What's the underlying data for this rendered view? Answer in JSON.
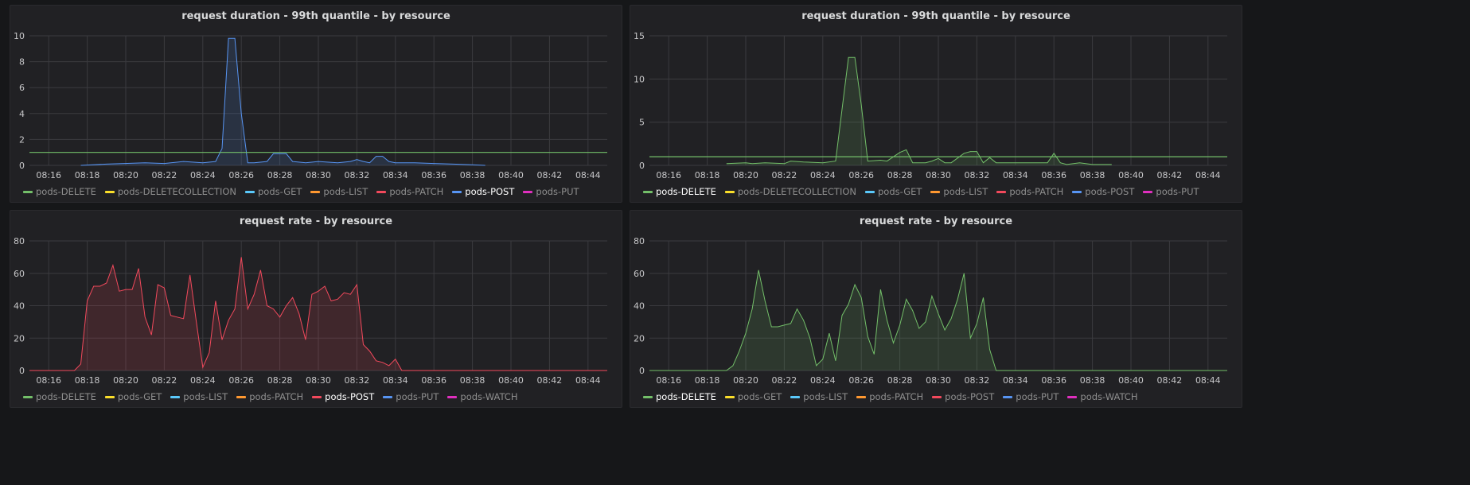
{
  "colors": {
    "DELETE": "#73bf69",
    "DELETECOLLECTION": "#fade2a",
    "GET": "#5ac8fa",
    "LIST": "#ff9830",
    "PATCH": "#f2495c",
    "POST": "#5794f2",
    "PUT": "#b877d9",
    "WATCH": "#b877d9"
  },
  "panels": [
    {
      "title": "request duration - 99th quantile - by resource",
      "legend": [
        {
          "label": "pods-DELETE",
          "color": "#73bf69",
          "selected": false
        },
        {
          "label": "pods-DELETECOLLECTION",
          "color": "#fade2a",
          "selected": false
        },
        {
          "label": "pods-GET",
          "color": "#5ac8fa",
          "selected": false
        },
        {
          "label": "pods-LIST",
          "color": "#ff9830",
          "selected": false
        },
        {
          "label": "pods-PATCH",
          "color": "#f2495c",
          "selected": false
        },
        {
          "label": "pods-POST",
          "color": "#5794f2",
          "selected": true
        },
        {
          "label": "pods-PUT",
          "color": "#e02fbf",
          "selected": false
        }
      ]
    },
    {
      "title": "request duration - 99th quantile - by resource",
      "legend": [
        {
          "label": "pods-DELETE",
          "color": "#73bf69",
          "selected": true
        },
        {
          "label": "pods-DELETECOLLECTION",
          "color": "#fade2a",
          "selected": false
        },
        {
          "label": "pods-GET",
          "color": "#5ac8fa",
          "selected": false
        },
        {
          "label": "pods-LIST",
          "color": "#ff9830",
          "selected": false
        },
        {
          "label": "pods-PATCH",
          "color": "#f2495c",
          "selected": false
        },
        {
          "label": "pods-POST",
          "color": "#5794f2",
          "selected": false
        },
        {
          "label": "pods-PUT",
          "color": "#e02fbf",
          "selected": false
        }
      ]
    },
    {
      "title": "request rate - by resource",
      "legend": [
        {
          "label": "pods-DELETE",
          "color": "#73bf69",
          "selected": false
        },
        {
          "label": "pods-GET",
          "color": "#fade2a",
          "selected": false
        },
        {
          "label": "pods-LIST",
          "color": "#5ac8fa",
          "selected": false
        },
        {
          "label": "pods-PATCH",
          "color": "#ff9830",
          "selected": false
        },
        {
          "label": "pods-POST",
          "color": "#f2495c",
          "selected": true
        },
        {
          "label": "pods-PUT",
          "color": "#5794f2",
          "selected": false
        },
        {
          "label": "pods-WATCH",
          "color": "#e02fbf",
          "selected": false
        }
      ]
    },
    {
      "title": "request rate - by resource",
      "legend": [
        {
          "label": "pods-DELETE",
          "color": "#73bf69",
          "selected": true
        },
        {
          "label": "pods-GET",
          "color": "#fade2a",
          "selected": false
        },
        {
          "label": "pods-LIST",
          "color": "#5ac8fa",
          "selected": false
        },
        {
          "label": "pods-PATCH",
          "color": "#ff9830",
          "selected": false
        },
        {
          "label": "pods-POST",
          "color": "#f2495c",
          "selected": false
        },
        {
          "label": "pods-PUT",
          "color": "#5794f2",
          "selected": false
        },
        {
          "label": "pods-WATCH",
          "color": "#e02fbf",
          "selected": false
        }
      ]
    }
  ],
  "chart_data": [
    {
      "type": "area",
      "title": "request duration - 99th quantile - by resource",
      "x_ticks": [
        "08:16",
        "08:18",
        "08:20",
        "08:22",
        "08:24",
        "08:26",
        "08:28",
        "08:30",
        "08:32",
        "08:34",
        "08:36",
        "08:38",
        "08:40",
        "08:42",
        "08:44"
      ],
      "x_range": [
        "08:15",
        "08:45"
      ],
      "ylim": [
        0,
        10
      ],
      "y_ticks": [
        0,
        2,
        4,
        6,
        8,
        10
      ],
      "threshold": 1,
      "series": [
        {
          "name": "pods-POST",
          "color": "#5794f2",
          "x": [
            "08:17:40",
            "08:19:00",
            "08:21:00",
            "08:22:00",
            "08:23:00",
            "08:24:00",
            "08:24:40",
            "08:25:00",
            "08:25:20",
            "08:25:40",
            "08:26:00",
            "08:26:20",
            "08:26:40",
            "08:27:20",
            "08:27:40",
            "08:28:00",
            "08:28:20",
            "08:28:40",
            "08:29:20",
            "08:30:00",
            "08:31:00",
            "08:31:40",
            "08:32:00",
            "08:32:20",
            "08:32:40",
            "08:33:00",
            "08:33:20",
            "08:33:40",
            "08:34:00",
            "08:35:00",
            "08:36:00",
            "08:37:00",
            "08:38:00",
            "08:38:40"
          ],
          "values": [
            0,
            0.1,
            0.2,
            0.15,
            0.3,
            0.2,
            0.3,
            1.3,
            9.8,
            9.8,
            4.0,
            0.2,
            0.2,
            0.3,
            0.9,
            0.9,
            0.9,
            0.3,
            0.2,
            0.3,
            0.2,
            0.3,
            0.45,
            0.3,
            0.2,
            0.7,
            0.7,
            0.3,
            0.2,
            0.2,
            0.15,
            0.1,
            0.05,
            0
          ]
        }
      ]
    },
    {
      "type": "area",
      "title": "request duration - 99th quantile - by resource",
      "x_ticks": [
        "08:16",
        "08:18",
        "08:20",
        "08:22",
        "08:24",
        "08:26",
        "08:28",
        "08:30",
        "08:32",
        "08:34",
        "08:36",
        "08:38",
        "08:40",
        "08:42",
        "08:44"
      ],
      "x_range": [
        "08:15",
        "08:45"
      ],
      "ylim": [
        0,
        15
      ],
      "y_ticks": [
        0,
        5,
        10,
        15
      ],
      "threshold": 1,
      "series": [
        {
          "name": "pods-DELETE",
          "color": "#73bf69",
          "x": [
            "08:19:00",
            "08:20:00",
            "08:20:20",
            "08:21:00",
            "08:22:00",
            "08:22:20",
            "08:23:00",
            "08:24:00",
            "08:24:40",
            "08:25:00",
            "08:25:20",
            "08:25:40",
            "08:26:00",
            "08:26:20",
            "08:27:00",
            "08:27:20",
            "08:28:00",
            "08:28:20",
            "08:28:40",
            "08:29:20",
            "08:29:40",
            "08:30:00",
            "08:30:20",
            "08:30:40",
            "08:31:20",
            "08:31:40",
            "08:32:00",
            "08:32:20",
            "08:32:40",
            "08:33:00",
            "08:33:20",
            "08:33:40",
            "08:34:00",
            "08:35:00",
            "08:35:40",
            "08:36:00",
            "08:36:20",
            "08:36:40",
            "08:37:20",
            "08:38:00",
            "08:39:00"
          ],
          "values": [
            0.2,
            0.3,
            0.2,
            0.3,
            0.2,
            0.5,
            0.4,
            0.3,
            0.5,
            6.5,
            12.5,
            12.5,
            7.0,
            0.5,
            0.6,
            0.5,
            1.5,
            1.8,
            0.3,
            0.3,
            0.5,
            0.8,
            0.3,
            0.3,
            1.4,
            1.6,
            1.6,
            0.3,
            0.9,
            0.3,
            0.3,
            0.3,
            0.3,
            0.3,
            0.3,
            1.4,
            0.3,
            0.1,
            0.3,
            0.1,
            0.1
          ]
        }
      ]
    },
    {
      "type": "area",
      "title": "request rate - by resource",
      "x_ticks": [
        "08:16",
        "08:18",
        "08:20",
        "08:22",
        "08:24",
        "08:26",
        "08:28",
        "08:30",
        "08:32",
        "08:34",
        "08:36",
        "08:38",
        "08:40",
        "08:42",
        "08:44"
      ],
      "x_range": [
        "08:15",
        "08:45"
      ],
      "ylim": [
        0,
        80
      ],
      "y_ticks": [
        0,
        20,
        40,
        60,
        80
      ],
      "series": [
        {
          "name": "pods-POST",
          "color": "#f2495c",
          "x": [
            "08:15:00",
            "08:17:20",
            "08:17:40",
            "08:18:00",
            "08:18:20",
            "08:18:40",
            "08:19:00",
            "08:19:20",
            "08:19:40",
            "08:20:00",
            "08:20:20",
            "08:20:40",
            "08:21:00",
            "08:21:20",
            "08:21:40",
            "08:22:00",
            "08:22:20",
            "08:22:40",
            "08:23:00",
            "08:23:20",
            "08:23:40",
            "08:24:00",
            "08:24:20",
            "08:24:40",
            "08:25:00",
            "08:25:20",
            "08:25:40",
            "08:26:00",
            "08:26:20",
            "08:26:40",
            "08:27:00",
            "08:27:20",
            "08:27:40",
            "08:28:00",
            "08:28:20",
            "08:28:40",
            "08:29:00",
            "08:29:20",
            "08:29:40",
            "08:30:00",
            "08:30:20",
            "08:30:40",
            "08:31:00",
            "08:31:20",
            "08:31:40",
            "08:32:00",
            "08:32:20",
            "08:32:40",
            "08:33:00",
            "08:33:20",
            "08:33:40",
            "08:34:00",
            "08:34:20",
            "08:34:40",
            "08:35:00",
            "08:35:20",
            "08:35:40",
            "08:36:00",
            "08:36:20",
            "08:36:40",
            "08:37:00",
            "08:37:20",
            "08:37:40",
            "08:38:00",
            "08:38:20",
            "08:38:40",
            "08:39:00",
            "08:45:00"
          ],
          "values": [
            0,
            0,
            4,
            43,
            52,
            52,
            54,
            65,
            49,
            50,
            50,
            63,
            33,
            22,
            53,
            51,
            34,
            33,
            32,
            59,
            30,
            2,
            11,
            43,
            19,
            31,
            38,
            70,
            38,
            47,
            62,
            40,
            38,
            33,
            40,
            45,
            35,
            19,
            47,
            49,
            52,
            43,
            44,
            48,
            47,
            53,
            16,
            12,
            6,
            5,
            3,
            7,
            0,
            0,
            0,
            0,
            0,
            0,
            0,
            0,
            0,
            0,
            0,
            0,
            0,
            0,
            0,
            0
          ]
        }
      ]
    },
    {
      "type": "area",
      "title": "request rate - by resource",
      "x_ticks": [
        "08:16",
        "08:18",
        "08:20",
        "08:22",
        "08:24",
        "08:26",
        "08:28",
        "08:30",
        "08:32",
        "08:34",
        "08:36",
        "08:38",
        "08:40",
        "08:42",
        "08:44"
      ],
      "x_range": [
        "08:15",
        "08:45"
      ],
      "ylim": [
        0,
        80
      ],
      "y_ticks": [
        0,
        20,
        40,
        60,
        80
      ],
      "series": [
        {
          "name": "pods-DELETE",
          "color": "#73bf69",
          "x": [
            "08:15:00",
            "08:19:00",
            "08:19:20",
            "08:19:40",
            "08:20:00",
            "08:20:20",
            "08:20:40",
            "08:21:00",
            "08:21:20",
            "08:21:40",
            "08:22:00",
            "08:22:20",
            "08:22:40",
            "08:23:00",
            "08:23:20",
            "08:23:40",
            "08:24:00",
            "08:24:20",
            "08:24:40",
            "08:25:00",
            "08:25:20",
            "08:25:40",
            "08:26:00",
            "08:26:20",
            "08:26:40",
            "08:27:00",
            "08:27:20",
            "08:27:40",
            "08:28:00",
            "08:28:20",
            "08:28:40",
            "08:29:00",
            "08:29:20",
            "08:29:40",
            "08:30:00",
            "08:30:20",
            "08:30:40",
            "08:31:00",
            "08:31:20",
            "08:31:40",
            "08:32:00",
            "08:32:20",
            "08:32:40",
            "08:33:00",
            "08:33:20",
            "08:33:40",
            "08:34:00",
            "08:34:20",
            "08:34:40",
            "08:35:00",
            "08:35:20",
            "08:35:40",
            "08:36:00",
            "08:36:20",
            "08:36:40",
            "08:37:00",
            "08:37:20",
            "08:37:40",
            "08:38:00",
            "08:38:20",
            "08:38:40",
            "08:39:00",
            "08:39:20",
            "08:39:40",
            "08:40:00",
            "08:45:00"
          ],
          "values": [
            0,
            0,
            3,
            12,
            23,
            38,
            62,
            43,
            27,
            27,
            28,
            29,
            38,
            31,
            20,
            3,
            7,
            23,
            6,
            34,
            41,
            53,
            45,
            21,
            10,
            50,
            31,
            17,
            28,
            44,
            37,
            26,
            30,
            46,
            35,
            25,
            32,
            44,
            60,
            20,
            29,
            45,
            13,
            0,
            0,
            0,
            0,
            0,
            0,
            0,
            0,
            0,
            0,
            0,
            0,
            0,
            0,
            0,
            0,
            0,
            0,
            0,
            0,
            0,
            0,
            0
          ]
        }
      ]
    }
  ]
}
